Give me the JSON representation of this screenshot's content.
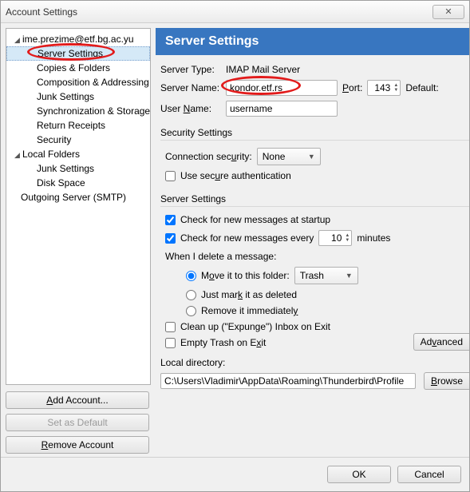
{
  "window_title": "Account Settings",
  "close_glyph": "✕",
  "tree": {
    "account_email": "ime.prezime@etf.bg.ac.yu",
    "items": [
      "Server Settings",
      "Copies & Folders",
      "Composition & Addressing",
      "Junk Settings",
      "Synchronization & Storage",
      "Return Receipts",
      "Security"
    ],
    "local_folders_label": "Local Folders",
    "local_items": [
      "Junk Settings",
      "Disk Space"
    ],
    "outgoing_label": "Outgoing Server (SMTP)"
  },
  "left_buttons": {
    "add": "Add Account...",
    "set_default": "Set as Default",
    "remove": "Remove Account"
  },
  "header": "Server Settings",
  "server_type_label": "Server Type:",
  "server_type_value": "IMAP Mail Server",
  "server_name_label": "Server Name:",
  "server_name_value": "kondor.etf.rs",
  "port_label": "Port:",
  "port_value": "143",
  "default_label": "Default:",
  "user_name_label": "User Name:",
  "user_name_value": "username",
  "security_section": "Security Settings",
  "conn_sec_label": "Connection security:",
  "conn_sec_value": "None",
  "use_secure_auth": "Use secure authentication",
  "server_section": "Server Settings",
  "check_startup": "Check for new messages at startup",
  "check_every_pre": "Check for new messages every",
  "check_every_value": "10",
  "check_every_post": "minutes",
  "when_delete": "When I delete a message:",
  "move_to_folder": "Move it to this folder:",
  "trash_value": "Trash",
  "mark_deleted": "Just mark it as deleted",
  "remove_immediately": "Remove it immediately",
  "clean_up": "Clean up (\"Expunge\") Inbox on Exit",
  "empty_trash": "Empty Trash on Exit",
  "advanced_btn": "Advanced",
  "local_dir_label": "Local directory:",
  "local_dir_value": "C:\\Users\\Vladimir\\AppData\\Roaming\\Thunderbird\\Profile",
  "browse_btn": "Browse",
  "ok_btn": "OK",
  "cancel_btn": "Cancel"
}
